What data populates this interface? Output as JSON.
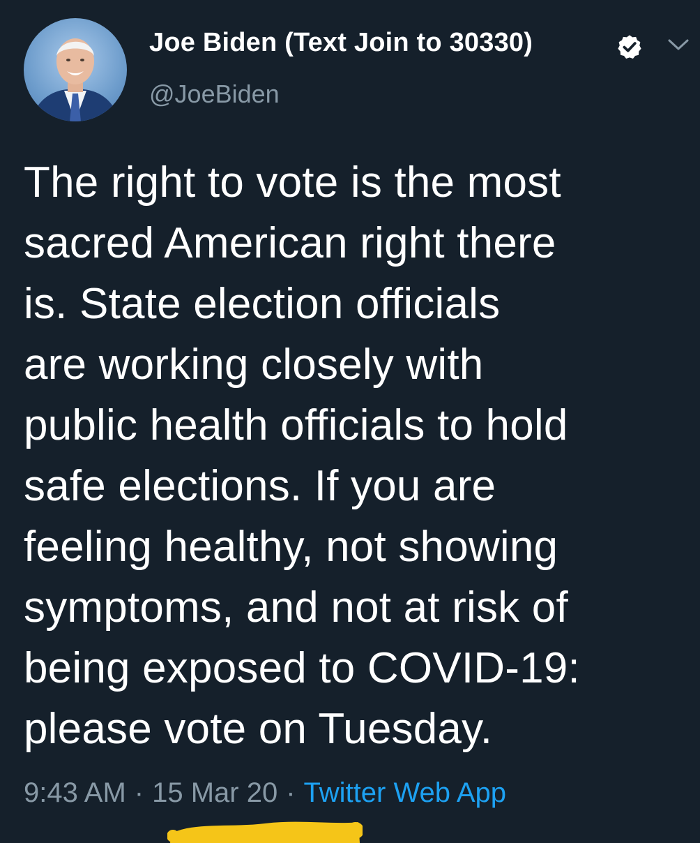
{
  "tweet": {
    "author": {
      "display_name": "Joe Biden (Text Join to 30330)",
      "handle": "@JoeBiden",
      "verified": true
    },
    "body_lines": [
      "The right to vote is the most",
      "sacred American right there",
      "is. State election officials",
      "are working closely with",
      "public health officials to hold",
      "safe elections. If you are",
      "feeling healthy, not showing",
      "symptoms, and not at risk of",
      "being exposed to COVID-19:",
      "please vote on Tuesday."
    ],
    "meta": {
      "time": "9:43 AM",
      "separator": "·",
      "date": "15 Mar 20",
      "source": "Twitter Web App"
    }
  },
  "icons": {
    "verified": "verified-badge-icon",
    "menu": "chevron-down-icon"
  },
  "colors": {
    "background": "#15202b",
    "primary_text": "#ffffff",
    "secondary_text": "#8899a6",
    "link": "#1da1f2",
    "highlight": "#f5c518"
  }
}
